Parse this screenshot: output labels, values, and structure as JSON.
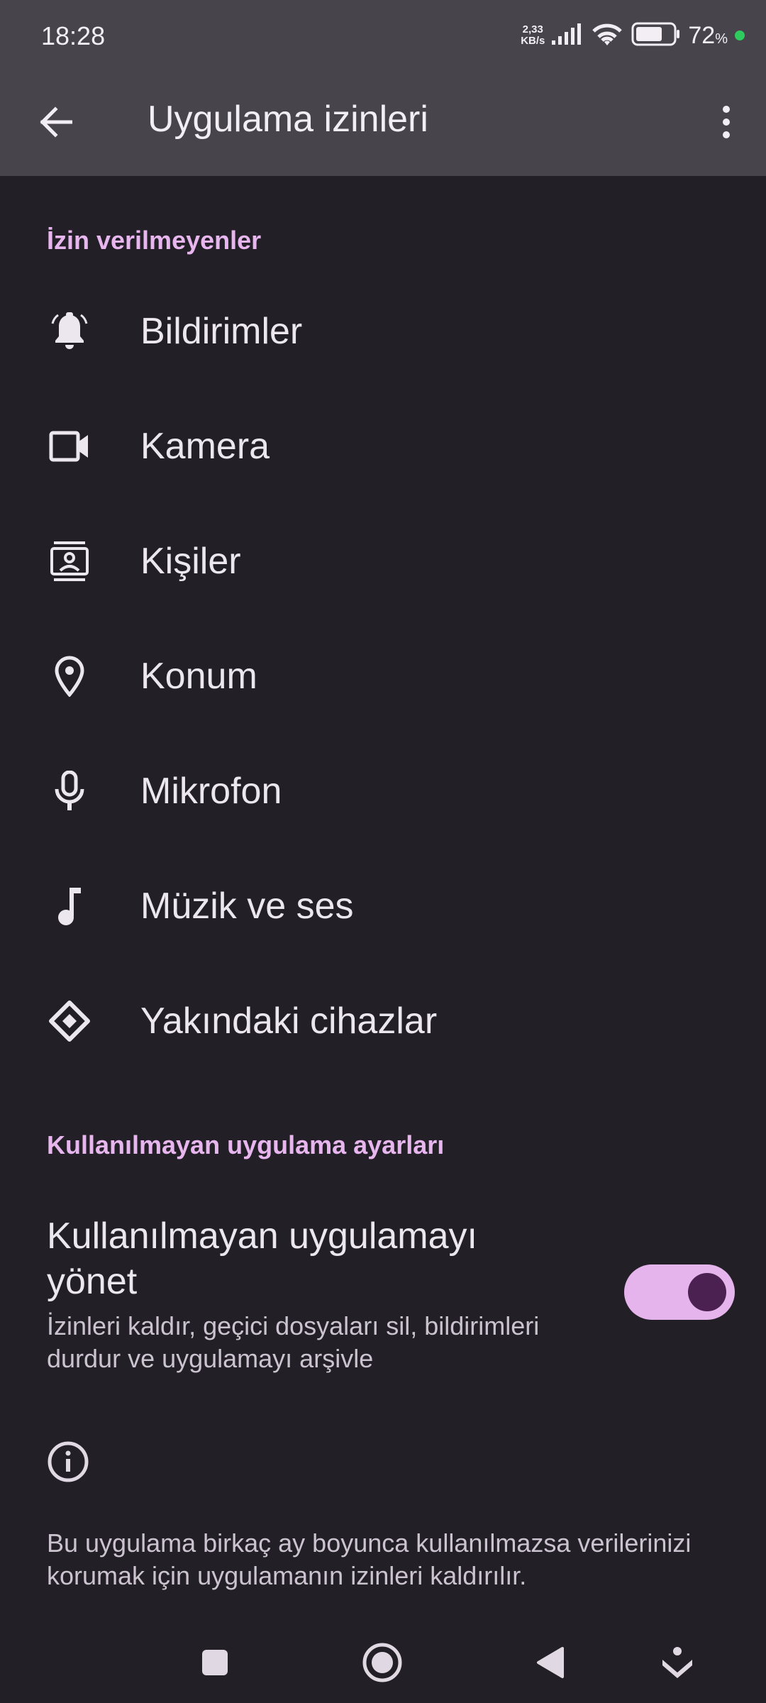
{
  "status": {
    "time": "18:28",
    "net_speed_value": "2,33",
    "net_speed_unit": "KB/s",
    "battery_percent": "72",
    "battery_unit": "%",
    "battery_level": 0.72
  },
  "appbar": {
    "title": "Uygulama izinleri",
    "back_icon": "arrow-back-icon",
    "more_icon": "more-vert-icon"
  },
  "denied_section": {
    "header": "İzin verilmeyenler",
    "items": [
      {
        "label": "Bildirimler",
        "icon": "bell-icon"
      },
      {
        "label": "Kamera",
        "icon": "camera-icon"
      },
      {
        "label": "Kişiler",
        "icon": "contacts-icon"
      },
      {
        "label": "Konum",
        "icon": "location-icon"
      },
      {
        "label": "Mikrofon",
        "icon": "microphone-icon"
      },
      {
        "label": "Müzik ve ses",
        "icon": "music-note-icon"
      },
      {
        "label": "Yakındaki cihazlar",
        "icon": "nearby-devices-icon"
      }
    ]
  },
  "unused_section": {
    "header": "Kullanılmayan uygulama ayarları",
    "manage_title": "Kullanılmayan uygulamayı yönet",
    "manage_desc": "İzinleri kaldır, geçici dosyaları sil, bildirimleri durdur ve uygulamayı arşivle",
    "toggle_on": true
  },
  "info": {
    "icon": "info-icon",
    "text": "Bu uygulama birkaç ay boyunca kullanılmazsa verilerinizi korumak için uygulamanın izinleri kaldırılır."
  },
  "colors": {
    "background": "#231f26",
    "appbar": "#48444c",
    "accent": "#e8b6ee",
    "toggle_track": "#e6b4ec",
    "toggle_knob": "#4a2150"
  }
}
